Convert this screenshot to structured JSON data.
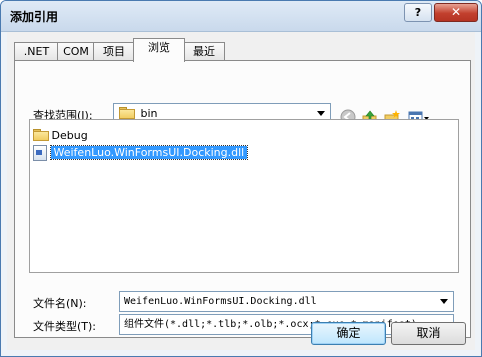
{
  "window": {
    "title": "添加引用"
  },
  "titlebar_buttons": {
    "help": "?",
    "close": "✕"
  },
  "tabs": [
    {
      "label": ".NET",
      "active": false
    },
    {
      "label": "COM",
      "active": false
    },
    {
      "label": "项目",
      "active": false
    },
    {
      "label": "浏览",
      "active": true
    },
    {
      "label": "最近",
      "active": false
    }
  ],
  "lookin": {
    "label": "查找范围(I):",
    "value": "bin"
  },
  "toolbar_icons": [
    "back-icon",
    "up-folder-icon",
    "new-folder-icon",
    "view-menu-icon"
  ],
  "files": [
    {
      "name": "Debug",
      "type": "folder",
      "selected": false
    },
    {
      "name": "WeifenLuo.WinFormsUI.Docking.dll",
      "type": "dll",
      "selected": true
    }
  ],
  "filename": {
    "label": "文件名(N):",
    "value": "WeifenLuo.WinFormsUI.Docking.dll"
  },
  "filetype": {
    "label": "文件类型(T):",
    "value": "组件文件(*.dll;*.tlb;*.olb;*.ocx;*.exe;*.manifest)"
  },
  "buttons": {
    "ok": "确定",
    "cancel": "取消"
  }
}
